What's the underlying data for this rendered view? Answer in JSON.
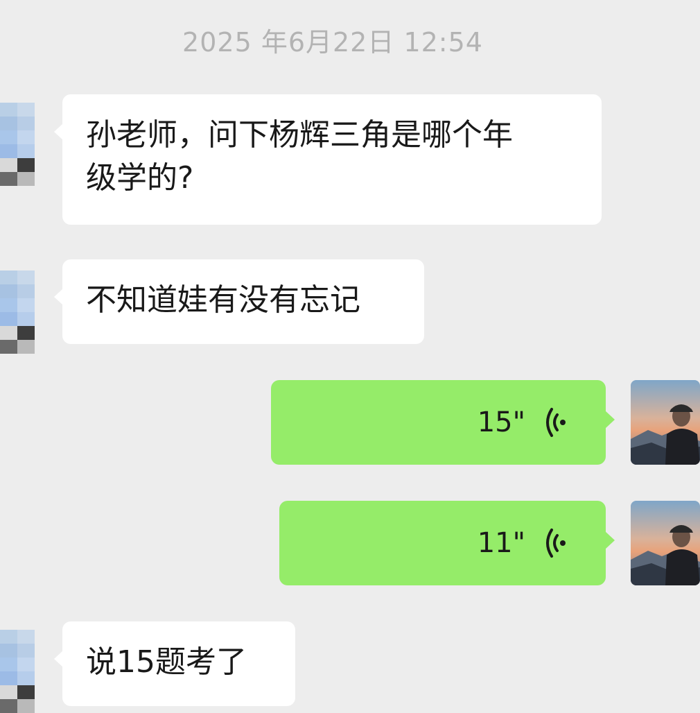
{
  "chat": {
    "timestamp": "2025 年6月22日 12:54",
    "messages": [
      {
        "sender": "other",
        "type": "text",
        "line1": "孙老师，问下杨辉三角是哪个年",
        "line2": "级学的?"
      },
      {
        "sender": "other",
        "type": "text",
        "text": "不知道娃有没有忘记"
      },
      {
        "sender": "me",
        "type": "voice",
        "duration": "15\"",
        "icon": "voice-wave-icon"
      },
      {
        "sender": "me",
        "type": "voice",
        "duration": "11\"",
        "icon": "voice-wave-icon"
      },
      {
        "sender": "other",
        "type": "text",
        "text": "说15题考了"
      }
    ]
  },
  "colors": {
    "background": "#ededed",
    "incoming_bubble": "#ffffff",
    "outgoing_bubble": "#95ec69",
    "timestamp": "#b3b3b3",
    "text": "#191919"
  }
}
